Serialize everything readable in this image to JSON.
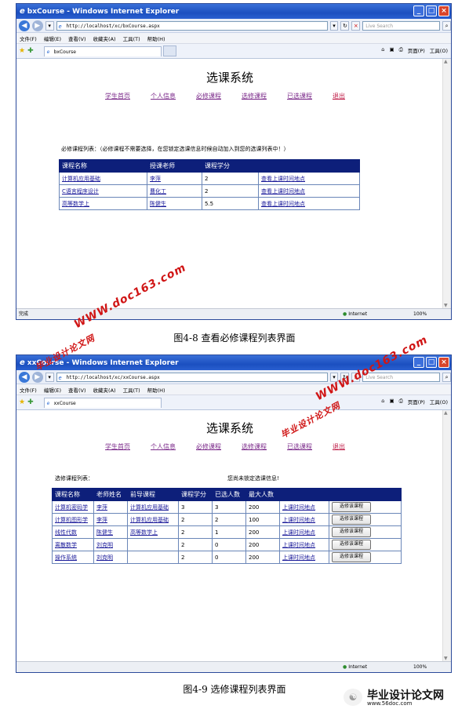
{
  "browser": {
    "window_title": "bxCourse - Windows Internet Explorer",
    "window_title2": "xxCourse - Windows Internet Explorer",
    "url1": "http://localhost/xc/bxCourse.aspx",
    "url2": "http://localhost/xc/xxCourse.aspx",
    "search_placeholder": "Live Search",
    "menu": [
      "文件(F)",
      "编辑(E)",
      "查看(V)",
      "收藏夹(A)",
      "工具(T)",
      "帮助(H)"
    ],
    "tab1": "bxCourse",
    "tab2": "xxCourse",
    "tools_page": "页面(P)",
    "tools_tools": "工具(O)",
    "status_done": "完成",
    "status_zone": "Internet",
    "status_zoom": "100%"
  },
  "app": {
    "title": "选课系统",
    "nav": [
      "学生首页",
      "个人信息",
      "必修课程",
      "选修课程",
      "已选课程",
      "退出"
    ]
  },
  "required": {
    "note": "必修课程列表：（必修课程不需要选择，在您锁定选课信息时候自动加入到您的选课列表中！）",
    "headers": [
      "课程名称",
      "授课老师",
      "课程学分",
      ""
    ],
    "rows": [
      [
        "计算机应用基础",
        "李萍",
        "2",
        "查看上课时间地点"
      ],
      [
        "C语言程序设计",
        "曹化工",
        "2",
        "查看上课时间地点"
      ],
      [
        "高等数学上",
        "陈健生",
        "5.5",
        "查看上课时间地点"
      ]
    ]
  },
  "elective": {
    "note": "选修课程列表：",
    "lock_note": "您尚未锁定选课信息!",
    "headers": [
      "课程名称",
      "老师姓名",
      "前导课程",
      "课程学分",
      "已选人数",
      "最大人数",
      "",
      ""
    ],
    "button_label": "选修该课程",
    "rows": [
      [
        "计算机密码学",
        "李萍",
        "计算机应用基础",
        "3",
        "3",
        "200",
        "上课时间地点"
      ],
      [
        "计算机图形学",
        "李萍",
        "计算机应用基础",
        "2",
        "2",
        "100",
        "上课时间地点"
      ],
      [
        "线性代数",
        "陈健生",
        "高等数学上",
        "2",
        "1",
        "200",
        "上课时间地点"
      ],
      [
        "离散数学",
        "刘克明",
        "",
        "2",
        "0",
        "200",
        "上课时间地点"
      ],
      [
        "操作系统",
        "刘克明",
        "",
        "2",
        "0",
        "200",
        "上课时间地点"
      ]
    ]
  },
  "captions": {
    "fig8": "图4-8  查看必修课程列表界面",
    "fig9": "图4-9  选修课程列表界面"
  },
  "watermarks": {
    "cn": "毕业设计论文网",
    "url": "WWW.doc163.com",
    "logo_cn": "毕业设计论文网",
    "logo_url": "www.56doc.com"
  }
}
